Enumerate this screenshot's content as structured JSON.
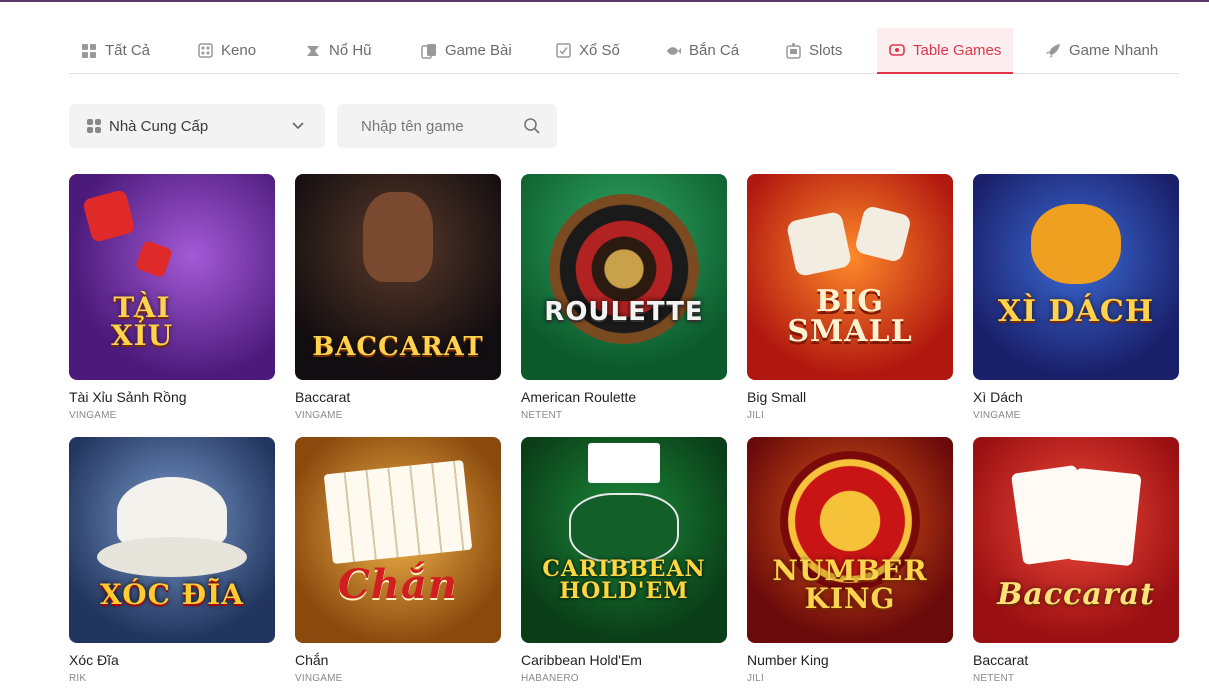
{
  "tabs": [
    {
      "label": "Tất Cả",
      "icon": "grid-icon",
      "active": false
    },
    {
      "label": "Keno",
      "icon": "keno-icon",
      "active": false
    },
    {
      "label": "Nổ Hũ",
      "icon": "jackpot-icon",
      "active": false
    },
    {
      "label": "Game Bài",
      "icon": "cards-icon",
      "active": false
    },
    {
      "label": "Xổ Số",
      "icon": "lottery-icon",
      "active": false
    },
    {
      "label": "Bắn Cá",
      "icon": "fish-icon",
      "active": false
    },
    {
      "label": "Slots",
      "icon": "slots-icon",
      "active": false
    },
    {
      "label": "Table Games",
      "icon": "table-games-icon",
      "active": true
    },
    {
      "label": "Game Nhanh",
      "icon": "rocket-icon",
      "active": false
    }
  ],
  "filters": {
    "provider_label": "Nhà Cung Cấp",
    "search_placeholder": "Nhập tên game"
  },
  "games": [
    {
      "name": "Tài Xỉu Sảnh Rồng",
      "provider": "VINGAME",
      "art": "TÀI\nXỈU"
    },
    {
      "name": "Baccarat",
      "provider": "VINGAME",
      "art": "BACCARAT"
    },
    {
      "name": "American Roulette",
      "provider": "NETENT",
      "art": "ROULETTE"
    },
    {
      "name": "Big Small",
      "provider": "JILI",
      "art": "BIG SMALL"
    },
    {
      "name": "Xì Dách",
      "provider": "VINGAME",
      "art": "XÌ DÁCH"
    },
    {
      "name": "Xóc Đĩa",
      "provider": "RIK",
      "art": "XÓC ĐĨA"
    },
    {
      "name": "Chắn",
      "provider": "VINGAME",
      "art": "Chắn"
    },
    {
      "name": "Caribbean Hold'Em",
      "provider": "HABANERO",
      "art": "CARIBBEAN\nHOLD'EM"
    },
    {
      "name": "Number King",
      "provider": "JILI",
      "art": "NUMBER\nKING"
    },
    {
      "name": "Baccarat",
      "provider": "NETENT",
      "art": "Baccarat"
    }
  ],
  "colors": {
    "accent": "#e0364a",
    "active_tab_bg": "#fdeef0",
    "tab_text": "#6b6b6b",
    "input_bg": "#f3f3f3"
  }
}
